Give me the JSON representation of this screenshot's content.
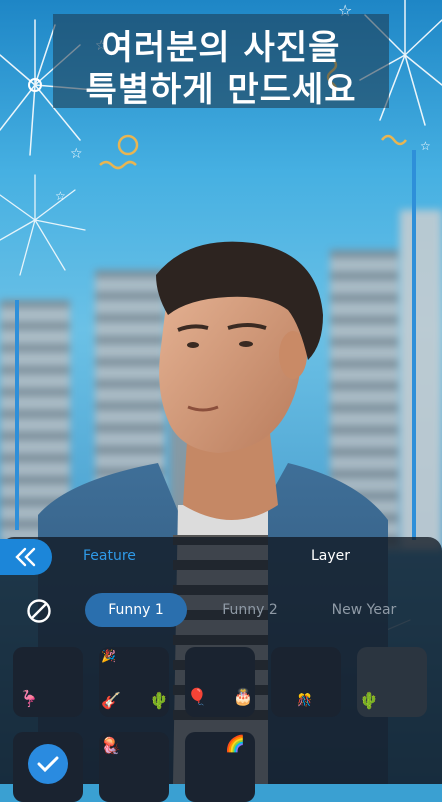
{
  "header": {
    "line1": "여러분의 사진을",
    "line2": "특별하게 만드세요"
  },
  "toolbar": {
    "tab_feature": "Feature",
    "tab_layer": "Layer"
  },
  "categories": [
    {
      "label": "Funny 1",
      "active": true
    },
    {
      "label": "Funny 2",
      "active": false
    },
    {
      "label": "New Year",
      "active": false
    }
  ],
  "colors": {
    "accent": "#2f9ae8",
    "panel": "#121a24",
    "chip_active": "#2a6fae"
  },
  "icons": {
    "back": "double-chevron-left-icon",
    "none": "no-frame-icon",
    "selected": "checkmark-icon"
  }
}
